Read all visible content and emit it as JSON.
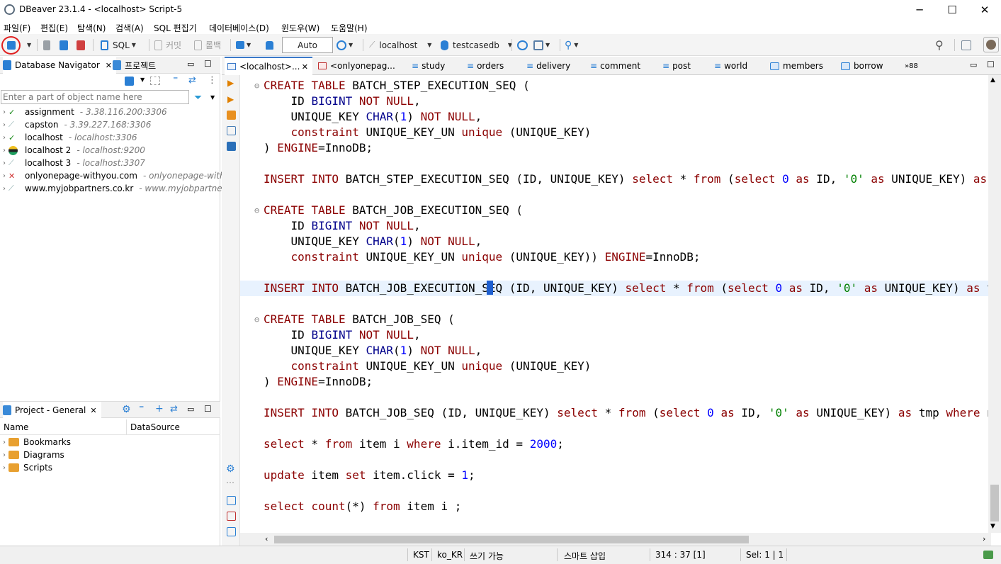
{
  "window": {
    "title": "DBeaver 23.1.4 - <localhost> Script-5",
    "minimize": "─",
    "maximize": "☐",
    "close": "✕"
  },
  "menu": [
    "파일(F)",
    "편집(E)",
    "탐색(N)",
    "검색(A)",
    "SQL 편집기",
    "데이터베이스(D)",
    "윈도우(W)",
    "도움말(H)"
  ],
  "toolbar": {
    "sql_label": "SQL",
    "commit_label": "커밋",
    "rollback_label": "롤백",
    "transaction_mode": "Auto",
    "datasource": "localhost",
    "schema": "testcasedb"
  },
  "navigator": {
    "tab_label": "Database Navigator",
    "project_tab_label": "프로젝트",
    "filter_placeholder": "Enter a part of object name here",
    "items": [
      {
        "name": "assignment",
        "host": "- 3.38.116.200:3306",
        "icon": "mysql-connected-icon"
      },
      {
        "name": "capston",
        "host": "- 3.39.227.168:3306",
        "icon": "mysql-icon"
      },
      {
        "name": "localhost",
        "host": "- localhost:3306",
        "icon": "mysql-connected-icon"
      },
      {
        "name": "localhost 2",
        "host": "- localhost:9200",
        "icon": "elasticsearch-icon"
      },
      {
        "name": "localhost 3",
        "host": "- localhost:3307",
        "icon": "mysql-icon"
      },
      {
        "name": "onlyonepage-withyou.com",
        "host": "- onlyonepage-withyo",
        "icon": "mysql-error-icon"
      },
      {
        "name": "www.myjobpartners.co.kr",
        "host": "- www.myjobpartners.c",
        "icon": "mysql-icon"
      }
    ]
  },
  "project": {
    "tab_label": "Project - General",
    "col_name": "Name",
    "col_datasource": "DataSource",
    "items": [
      "Bookmarks",
      "Diagrams",
      "Scripts"
    ]
  },
  "editor_tabs": [
    {
      "label": "<localhost>...",
      "active": true
    },
    {
      "label": "<onlyonepag...",
      "active": false
    },
    {
      "label": "study"
    },
    {
      "label": "orders"
    },
    {
      "label": "delivery"
    },
    {
      "label": "comment"
    },
    {
      "label": "post"
    },
    {
      "label": "world"
    },
    {
      "label": "members"
    },
    {
      "label": "borrow"
    },
    {
      "label": "»88"
    }
  ],
  "code_lines": [
    "⊖CREATE TABLE BATCH_STEP_EXECUTION_SEQ (",
    "    ID BIGINT NOT NULL,",
    "    UNIQUE_KEY CHAR(1) NOT NULL,",
    "    constraint UNIQUE_KEY_UN unique (UNIQUE_KEY)",
    ") ENGINE=InnoDB;",
    "",
    "INSERT INTO BATCH_STEP_EXECUTION_SEQ (ID, UNIQUE_KEY) select * from (select 0 as ID, '0' as UNIQUE_KEY) as tmp where",
    "",
    "⊖CREATE TABLE BATCH_JOB_EXECUTION_SEQ (",
    "    ID BIGINT NOT NULL,",
    "    UNIQUE_KEY CHAR(1) NOT NULL,",
    "    constraint UNIQUE_KEY_UN unique (UNIQUE_KEY)) ENGINE=InnoDB;",
    "",
    "INSERT INTO BATCH_JOB_EXECUTION_SEQ (ID, UNIQUE_KEY) select * from (select 0 as ID, '0' as UNIQUE_KEY) as tmp wher",
    "",
    "⊖CREATE TABLE BATCH_JOB_SEQ (",
    "    ID BIGINT NOT NULL,",
    "    UNIQUE_KEY CHAR(1) NOT NULL,",
    "    constraint UNIQUE_KEY_UN unique (UNIQUE_KEY)",
    ") ENGINE=InnoDB;",
    "",
    "INSERT INTO BATCH_JOB_SEQ (ID, UNIQUE_KEY) select * from (select 0 as ID, '0' as UNIQUE_KEY) as tmp where not exis",
    "",
    "select * from item i where i.item_id = 2000;",
    "",
    "update item set item.click = 1;",
    "",
    "select count(*) from item i ;"
  ],
  "status": {
    "timezone": "KST",
    "locale": "ko_KR",
    "write_mode": "쓰기 가능",
    "insert_mode": "스마트 삽입",
    "position": "314 : 37 [1]",
    "selection": "Sel: 1 | 1"
  },
  "colors": {
    "keyword": "#8b0000",
    "type": "#00008b",
    "number": "#0000ff",
    "string": "#008000",
    "highlight_line": "#e8f2fe"
  }
}
